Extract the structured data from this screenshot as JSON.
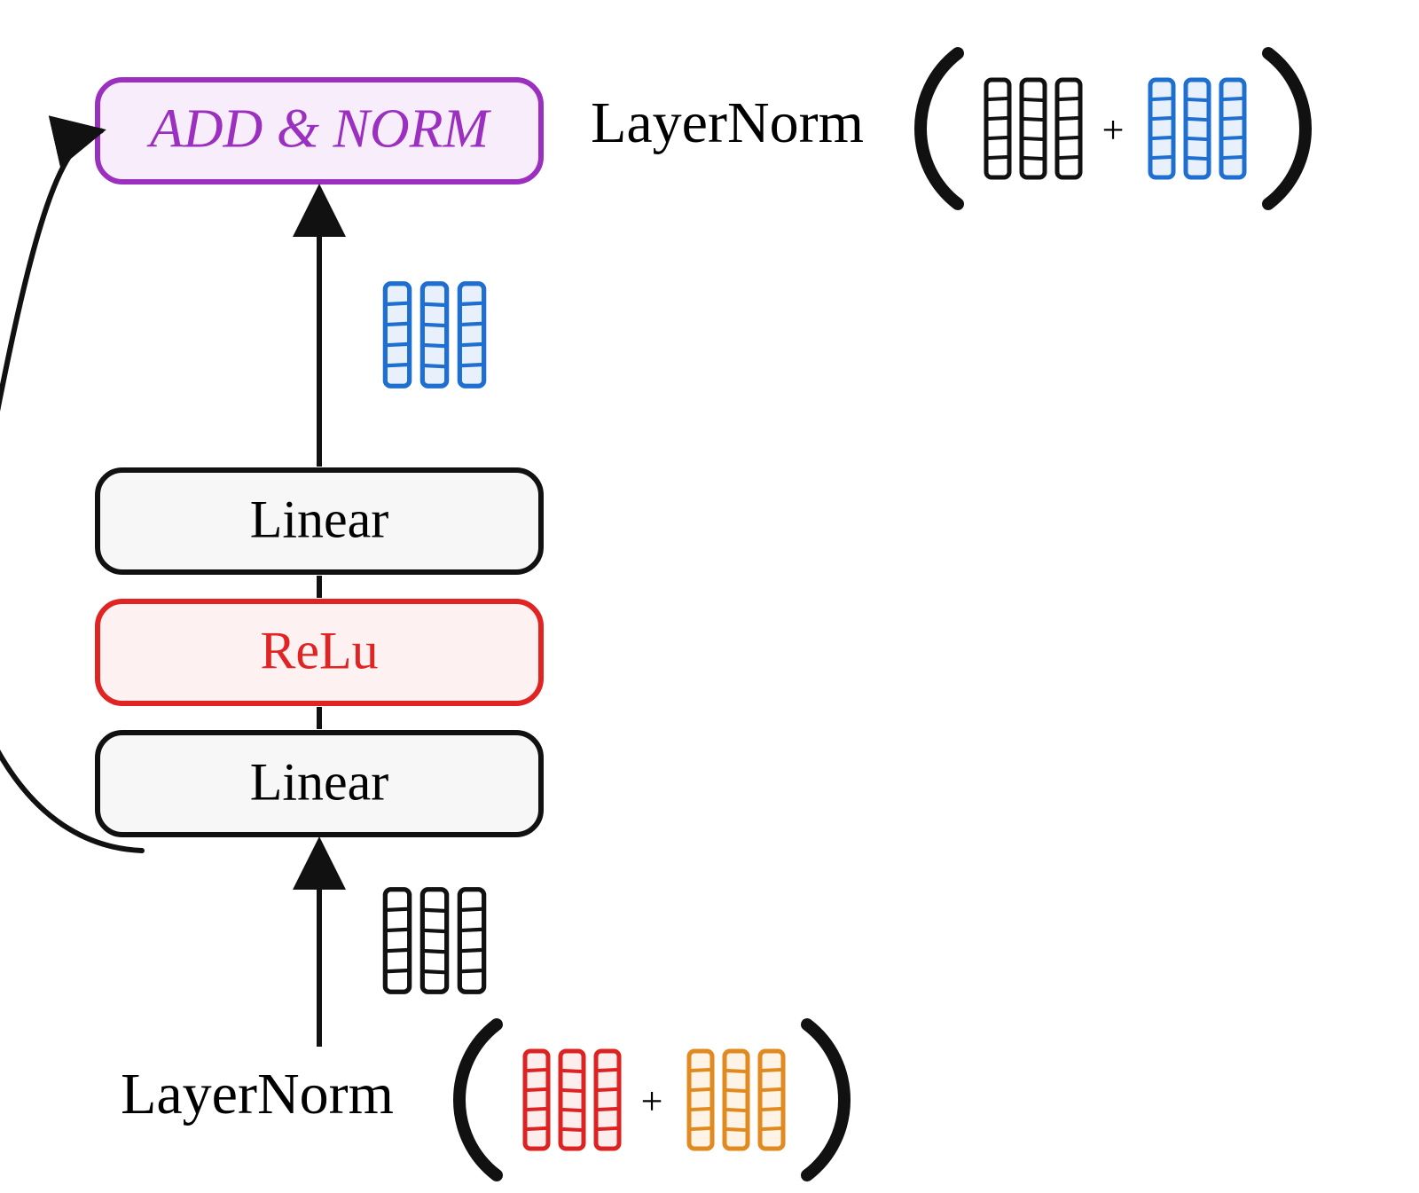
{
  "blocks": {
    "addnorm": "ADD & NORM",
    "linear_top": "Linear",
    "relu": "ReLu",
    "linear_bottom": "Linear"
  },
  "labels": {
    "layernorm_top": "LayerNorm",
    "layernorm_bottom": "LayerNorm",
    "plus": "+"
  },
  "colors": {
    "purple": "#9b2fbf",
    "purple_fill": "#f7edfb",
    "red": "#e02424",
    "red_fill": "#fef1f1",
    "black": "#111111",
    "grey_fill": "#f7f7f8",
    "blue": "#1f6fd0",
    "blue_fill": "#e8f1fb",
    "orange": "#e08a1f",
    "orange_fill": "#fdf3e6",
    "red2": "#d22",
    "red2_fill": "#fdeeee"
  },
  "tensor": {
    "cols": 3,
    "rows": 5
  }
}
